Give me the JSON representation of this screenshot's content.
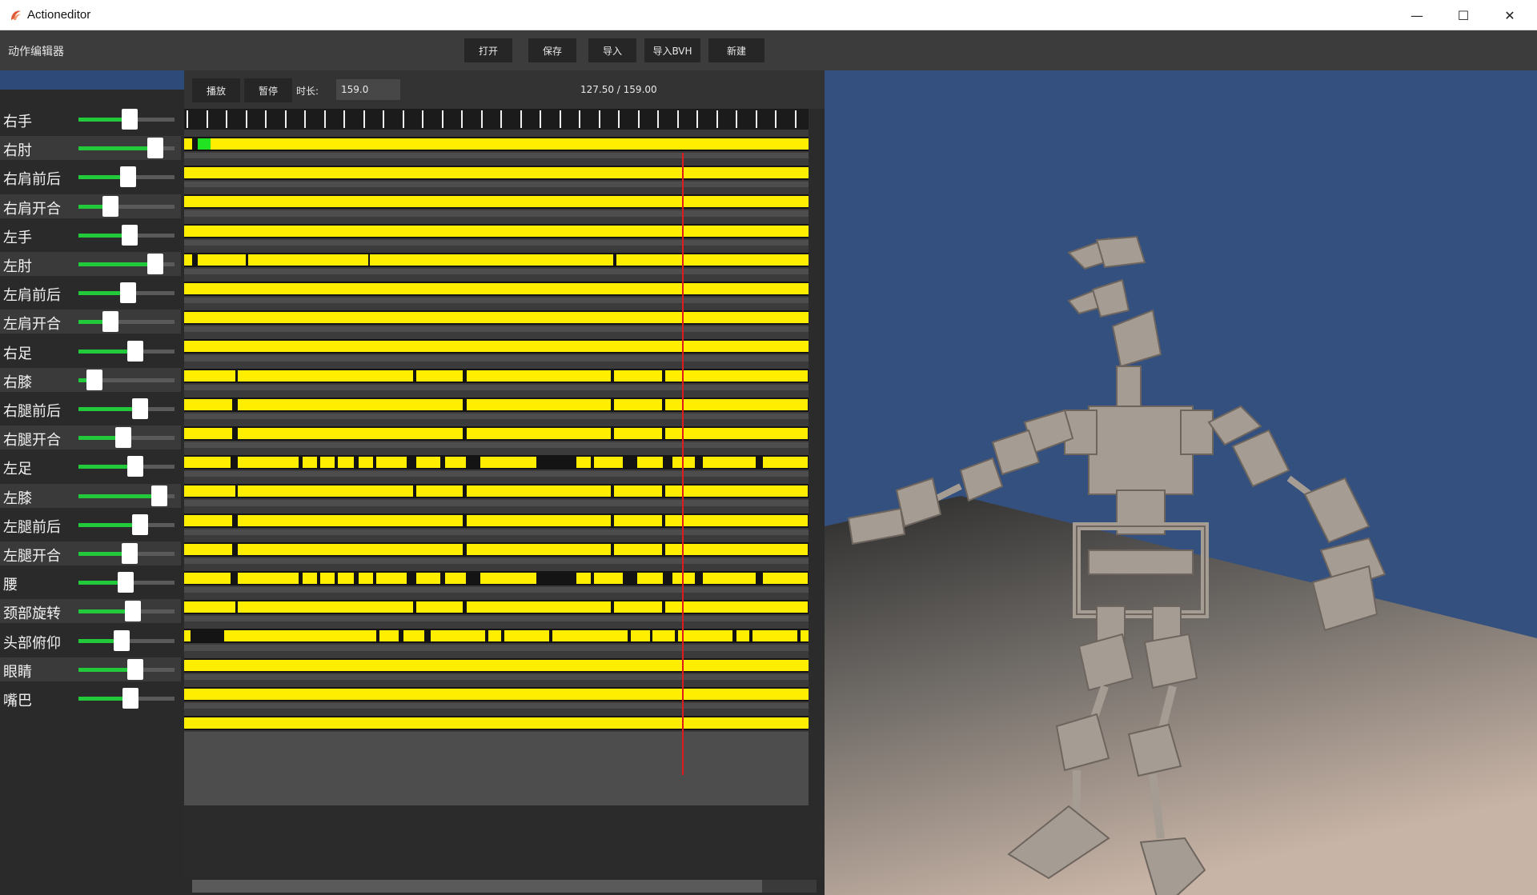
{
  "window": {
    "title": "Actioneditor",
    "minimize_glyph": "—",
    "maximize_glyph": "☐",
    "close_glyph": "✕"
  },
  "toolbar": {
    "title": "动作编辑器",
    "open_label": "打开",
    "save_label": "保存",
    "import_label": "导入",
    "import_bvh_label": "导入BVH",
    "new_label": "新建"
  },
  "timeline": {
    "play_label": "播放",
    "pause_label": "暂停",
    "duration_label": "时长:",
    "duration_value": "159.0",
    "time_readout": "127.50 / 159.00",
    "current_time": 127.5,
    "total_time": 159.0
  },
  "joints": [
    {
      "label": "右手",
      "value": 0.53
    },
    {
      "label": "右肘",
      "value": 0.8
    },
    {
      "label": "右肩前后",
      "value": 0.52
    },
    {
      "label": "右肩开合",
      "value": 0.33
    },
    {
      "label": "左手",
      "value": 0.53
    },
    {
      "label": "左肘",
      "value": 0.8
    },
    {
      "label": "左肩前后",
      "value": 0.52
    },
    {
      "label": "左肩开合",
      "value": 0.33
    },
    {
      "label": "右足",
      "value": 0.59
    },
    {
      "label": "右膝",
      "value": 0.17
    },
    {
      "label": "右腿前后",
      "value": 0.64
    },
    {
      "label": "右腿开合",
      "value": 0.47
    },
    {
      "label": "左足",
      "value": 0.59
    },
    {
      "label": "左膝",
      "value": 0.84
    },
    {
      "label": "左腿前后",
      "value": 0.64
    },
    {
      "label": "左腿开合",
      "value": 0.53
    },
    {
      "label": "腰",
      "value": 0.49
    },
    {
      "label": "颈部旋转",
      "value": 0.57
    },
    {
      "label": "头部俯仰",
      "value": 0.45
    },
    {
      "label": "眼睛",
      "value": 0.59
    },
    {
      "label": "嘴巴",
      "value": 0.54
    }
  ],
  "colors": {
    "keyframe_segment": "#ffee00",
    "selected_keyframe": "#22e322",
    "slider_fill": "#22c93a",
    "playhead": "#e01b1b",
    "viewport_wall": "#34507f"
  },
  "icons": {
    "app": "app-icon",
    "minimize": "minimize-icon",
    "maximize": "maximize-icon",
    "close": "close-icon"
  }
}
